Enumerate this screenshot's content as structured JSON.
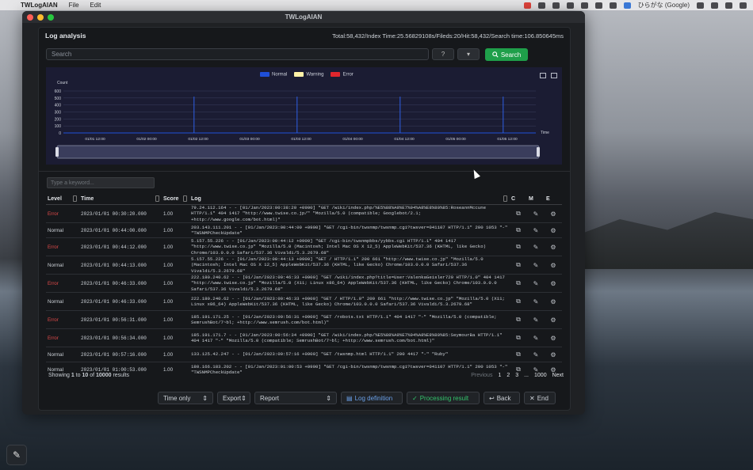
{
  "menubar": {
    "app_name": "TWLogAIAN",
    "items": [
      "File",
      "Edit"
    ],
    "input_method": "ひらがな (Google)"
  },
  "window": {
    "title": "TWLogAIAN"
  },
  "card": {
    "title": "Log analysis",
    "stats": "Total:58,432/Index Time:25.56829108s/Fileds:20/Hit:58,432/Search time:106.850645ms"
  },
  "search": {
    "placeholder": "Search",
    "help_icon": "?",
    "dropdown_icon": "▾",
    "button_label": "Search"
  },
  "chart_data": {
    "type": "line",
    "title": "",
    "ylabel": "Count",
    "xlabel": "Time",
    "ylim": [
      0,
      600
    ],
    "yticks": [
      0,
      100,
      200,
      300,
      400,
      500,
      600
    ],
    "x_ticks": [
      "01/01 12:00",
      "01/02 00:00",
      "01/02 12:00",
      "01/03 00:00",
      "01/03 12:00",
      "01/04 00:00",
      "01/04 12:00",
      "01/05 00:00",
      "01/05 12:00"
    ],
    "legend": [
      "Normal",
      "Warning",
      "Error"
    ],
    "colors": {
      "Normal": "#1f4fd8",
      "Warning": "#fff2a8",
      "Error": "#e0262d"
    },
    "spikes": [
      {
        "x": "01/01 23:00",
        "y": 520
      },
      {
        "x": "01/02 23:00",
        "y": 520
      },
      {
        "x": "01/03 23:00",
        "y": 520
      },
      {
        "x": "01/04 23:00",
        "y": 520
      }
    ]
  },
  "keyword_filter": {
    "placeholder": "Type a keyword..."
  },
  "table": {
    "headers": [
      "Level",
      "Time",
      "Score",
      "Log",
      "C",
      "M",
      "E"
    ],
    "rows": [
      {
        "level": "Error",
        "time": "2023/01/01 00:30:20.000",
        "score": "1.00",
        "log": "79.24.112.164 - - [01/Jan/2023:00:38:20 +0900] \"GET /wiki/index.php/%E5%88%A9%E7%94%A8%E8%80%85:RoseannMccune HTTP/1.1\" 404 1417 \"http://www.twise.co.jp/\" \"Mozilla/5.0 (compatible; Googlebot/2.1; +http://www.google.com/bot.html)\""
      },
      {
        "level": "Normal",
        "time": "2023/01/01 00:44:00.000",
        "score": "1.00",
        "log": "203.143.111.201 - - [01/Jan/2023:00:44:00 +0900] \"GET /cgi-bin/twsnmp/twsnmp.cgi?twsver=041107 HTTP/1.1\" 200 1053 \"-\" \"TWSNMPCheckUpdate\""
      },
      {
        "level": "Error",
        "time": "2023/01/01 00:44:12.000",
        "score": "1.00",
        "log": "5.157.55.226 - - [01/Jan/2023:00:44:12 +0900] \"GET /cgi-bin/twsnmpbbs/yybbs.cgi HTTP/1.1\" 404 1417 \"http://www.twise.co.jp\" \"Mozilla/5.0 (Macintosh; Intel Mac OS X 12_5) AppleWebKit/537.36 (KHTML, like Gecko) Chrome/103.0.0.0 Safari/537.36 Vivaldi/5.3.2679.68\""
      },
      {
        "level": "Normal",
        "time": "2023/01/01 00:44:13.000",
        "score": "1.00",
        "log": "5.157.55.226 - - [01/Jan/2023:00:44:13 +0900] \"GET / HTTP/1.1\" 200 661 \"http://www.twise.co.jp\" \"Mozilla/5.0 (Macintosh; Intel Mac OS X 12_5) AppleWebKit/537.36 (KHTML, like Gecko) Chrome/103.0.0.0 Safari/537.36 Vivaldi/5.3.2679.68\""
      },
      {
        "level": "Error",
        "time": "2023/01/01 00:46:33.000",
        "score": "1.00",
        "log": "222.180.240.62 - - [01/Jan/2023:00:46:33 +0900] \"GET /wiki/index.php?title=User:ValenkaGeisler720 HTTP/1.0\" 404 1417 \"http://www.twise.co.jp\" \"Mozilla/5.0 (X11; Linux x86_64) AppleWebKit/537.36 (KHTML, like Gecko) Chrome/103.0.0.0 Safari/537.36 Vivaldi/5.3.2679.68\""
      },
      {
        "level": "Normal",
        "time": "2023/01/01 00:46:33.000",
        "score": "1.00",
        "log": "222.180.240.62 - - [01/Jan/2023:00:46:33 +0900] \"GET / HTTP/1.0\" 200 661 \"http://www.twise.co.jp\" \"Mozilla/5.0 (X11; Linux x86_64) AppleWebKit/537.36 (KHTML, like Gecko) Chrome/103.0.0.0 Safari/537.36 Vivaldi/5.3.2679.68\""
      },
      {
        "level": "Error",
        "time": "2023/01/01 00:56:31.000",
        "score": "1.00",
        "log": "185.191.171.25 - - [01/Jan/2023:00:56:31 +0900] \"GET /robots.txt HTTP/1.1\" 404 1417 \"-\" \"Mozilla/5.0 (compatible; SemrushBot/7~bl; +http://www.semrush.com/bot.html)\""
      },
      {
        "level": "Error",
        "time": "2023/01/01 00:56:34.000",
        "score": "1.00",
        "log": "185.191.171.7 - - [01/Jan/2023:00:56:34 +0900] \"GET /wiki/index.php/%E5%88%A9%E7%94%A8%E8%80%85:SeymourBa HTTP/1.1\" 404 1417 \"-\" \"Mozilla/5.0 (compatible; SemrushBot/7~bl; +http://www.semrush.com/bot.html)\""
      },
      {
        "level": "Normal",
        "time": "2023/01/01 00:57:16.000",
        "score": "1.00",
        "log": "133.125.42.247 - - [01/Jan/2023:00:57:16 +0900] \"GET /twsnmp.html HTTP/1.1\" 200 4417 \"-\" \"Ruby\""
      },
      {
        "level": "Normal",
        "time": "2023/01/01 01:00:53.000",
        "score": "1.00",
        "log": "180.166.183.202 - - [01/Jan/2023:01:00:53 +0900] \"GET /cgi-bin/twsnmp/twsnmp.cgi?twsver=041107 HTTP/1.1\" 200 1053 \"-\" \"TWSNMPCheckUpdate\""
      }
    ]
  },
  "footer": {
    "showing_prefix": "Showing",
    "showing_from": "1",
    "showing_to_word": "to",
    "showing_to": "10",
    "showing_of_word": "of",
    "showing_total": "10000",
    "showing_suffix": "results",
    "pager": {
      "previous": "Previous",
      "pages": [
        "1",
        "2",
        "3",
        "...",
        "1000"
      ],
      "next": "Next"
    }
  },
  "bottombar": {
    "time_select": "Time only",
    "export_select": "Export",
    "report_select": "Report",
    "log_definition": "Log definition",
    "processing_result": "Processing result",
    "back": "Back",
    "end": "End"
  }
}
